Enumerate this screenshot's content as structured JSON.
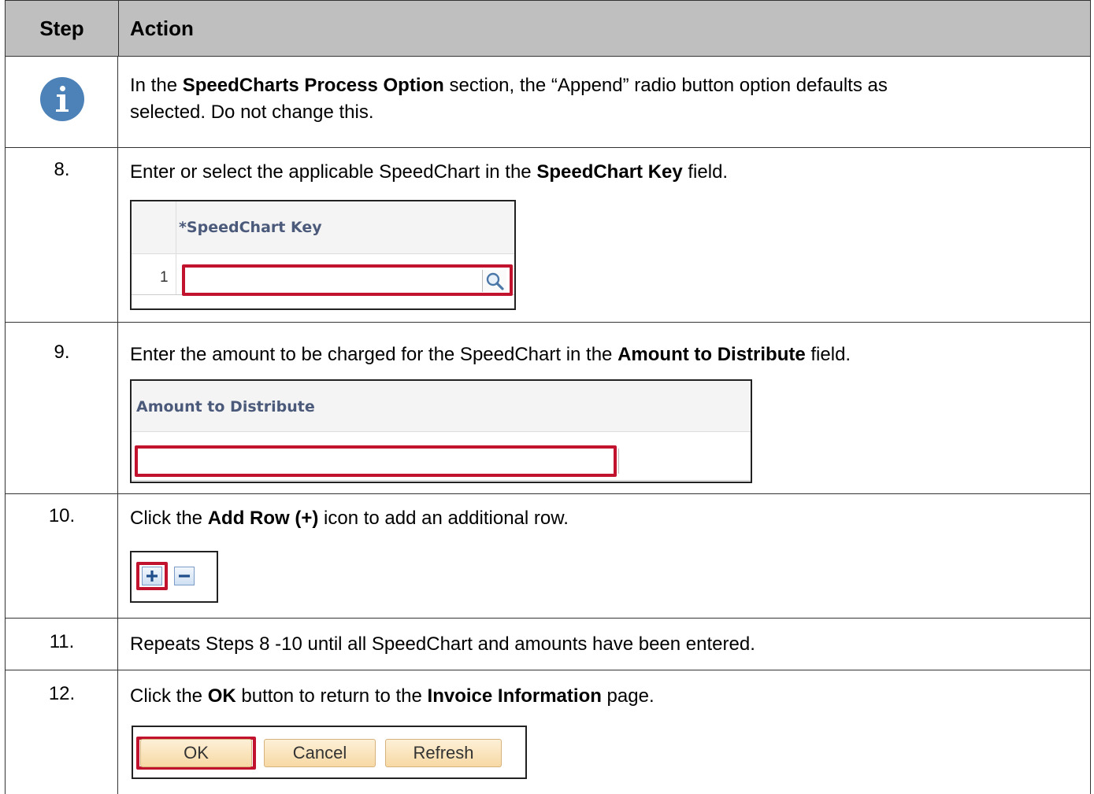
{
  "header": {
    "step": "Step",
    "action": "Action"
  },
  "rows": {
    "info": {
      "pre": "In the ",
      "bold1": "SpeedCharts Process Option",
      "post1": " section, the “Append” radio button option defaults as",
      "line2": "selected.  Do not change this."
    },
    "s8": {
      "num": "8.",
      "pre": "Enter or select the applicable SpeedChart in the ",
      "bold": "SpeedChart Key",
      "post": " field.",
      "shot": {
        "column_label": "*SpeedChart Key",
        "row_number": "1",
        "value": ""
      }
    },
    "s9": {
      "num": "9.",
      "pre": "Enter the amount to be charged for the SpeedChart in the ",
      "bold": "Amount to Distribute",
      "post": " field.",
      "shot": {
        "column_label": "Amount to Distribute",
        "value": ""
      }
    },
    "s10": {
      "num": "10.",
      "pre": "Click the ",
      "bold": "Add Row (+)",
      "post": " icon to add an additional row."
    },
    "s11": {
      "num": "11.",
      "text": "Repeats Steps 8 -10 until all SpeedChart and amounts have been entered."
    },
    "s12": {
      "num": "12.",
      "pre": "Click the ",
      "bold1": "OK",
      "mid": " button to return to the ",
      "bold2": "Invoice Information",
      "post": " page.",
      "buttons": {
        "ok": "OK",
        "cancel": "Cancel",
        "refresh": "Refresh"
      }
    }
  },
  "colors": {
    "header_bg": "#bfbfbf",
    "highlight": "#c1122e",
    "info_icon": "#4d82b8"
  }
}
